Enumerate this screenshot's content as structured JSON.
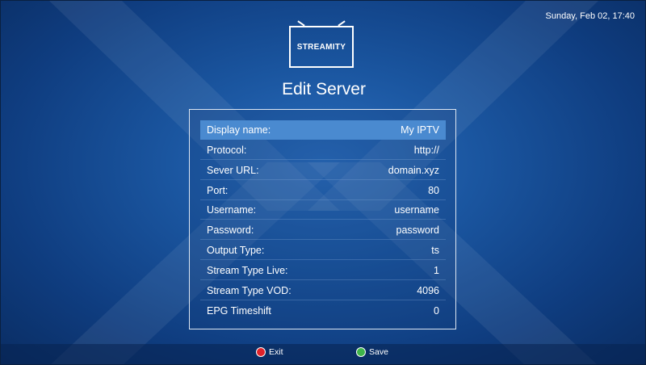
{
  "app": {
    "datetime": "Sunday, Feb 02, 17:40",
    "logo_text": "STREAMITY",
    "title": "Edit Server"
  },
  "fields": [
    {
      "label": "Display name:",
      "value": "My IPTV"
    },
    {
      "label": "Protocol:",
      "value": "http://"
    },
    {
      "label": "Sever URL:",
      "value": "domain.xyz"
    },
    {
      "label": "Port:",
      "value": "80"
    },
    {
      "label": "Username:",
      "value": "username"
    },
    {
      "label": "Password:",
      "value": "password"
    },
    {
      "label": "Output Type:",
      "value": "ts"
    },
    {
      "label": "Stream Type Live:",
      "value": "1"
    },
    {
      "label": "Stream Type VOD:",
      "value": "4096"
    },
    {
      "label": "EPG Timeshift",
      "value": "0"
    }
  ],
  "footer": {
    "exit_label": "Exit",
    "save_label": "Save"
  },
  "colors": {
    "selected_row": "#4a8ad0",
    "exit_button": "#e0222a",
    "save_button": "#3fb54a"
  }
}
